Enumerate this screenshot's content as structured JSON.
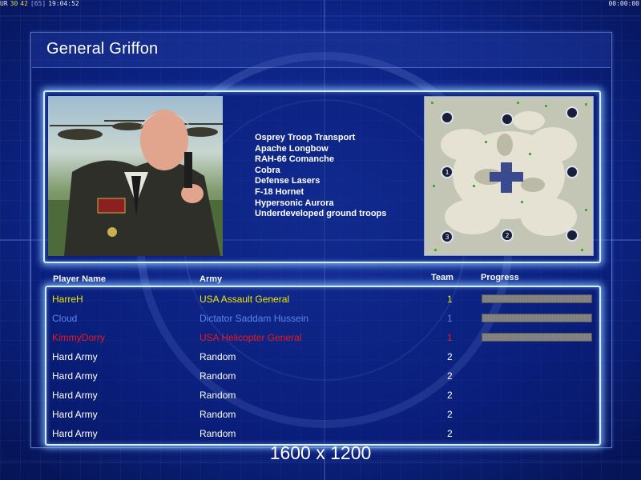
{
  "status_bar": {
    "seg1": "UR",
    "seg2": "30",
    "seg3": "42",
    "seg4": "[65]",
    "time": "19:04:52",
    "timer": "00:00:00"
  },
  "general": {
    "name": "General Griffon",
    "units": [
      "Osprey Troop Transport",
      "Apache Longbow",
      "RAH-66 Comanche",
      "Cobra",
      "Defense Lasers",
      "F-18 Hornet",
      "Hypersonic Aurora",
      "Underdeveloped ground troops"
    ]
  },
  "map": {
    "start_markers": [
      "1",
      "2",
      "3"
    ]
  },
  "table": {
    "headers": {
      "player": "Player Name",
      "army": "Army",
      "team": "Team",
      "progress": "Progress"
    },
    "rows": [
      {
        "name": "HarreH",
        "army": "USA Assault General",
        "team": "1",
        "color": "#f2e600",
        "progress": 1.0
      },
      {
        "name": "Cloud",
        "army": "Dictator Saddam Hussein",
        "team": "1",
        "color": "#5a86f0",
        "progress": 1.0
      },
      {
        "name": "KimmyDorry",
        "army": "USA Helicopter General",
        "team": "1",
        "color": "#f01818",
        "progress": 1.0
      },
      {
        "name": "Hard Army",
        "army": "Random",
        "team": "2",
        "color": "#ffffff"
      },
      {
        "name": "Hard Army",
        "army": "Random",
        "team": "2",
        "color": "#ffffff"
      },
      {
        "name": "Hard Army",
        "army": "Random",
        "team": "2",
        "color": "#ffffff"
      },
      {
        "name": "Hard Army",
        "army": "Random",
        "team": "2",
        "color": "#ffffff"
      },
      {
        "name": "Hard Army",
        "army": "Random",
        "team": "2",
        "color": "#ffffff"
      }
    ]
  },
  "resolution": "1600 x 1200"
}
